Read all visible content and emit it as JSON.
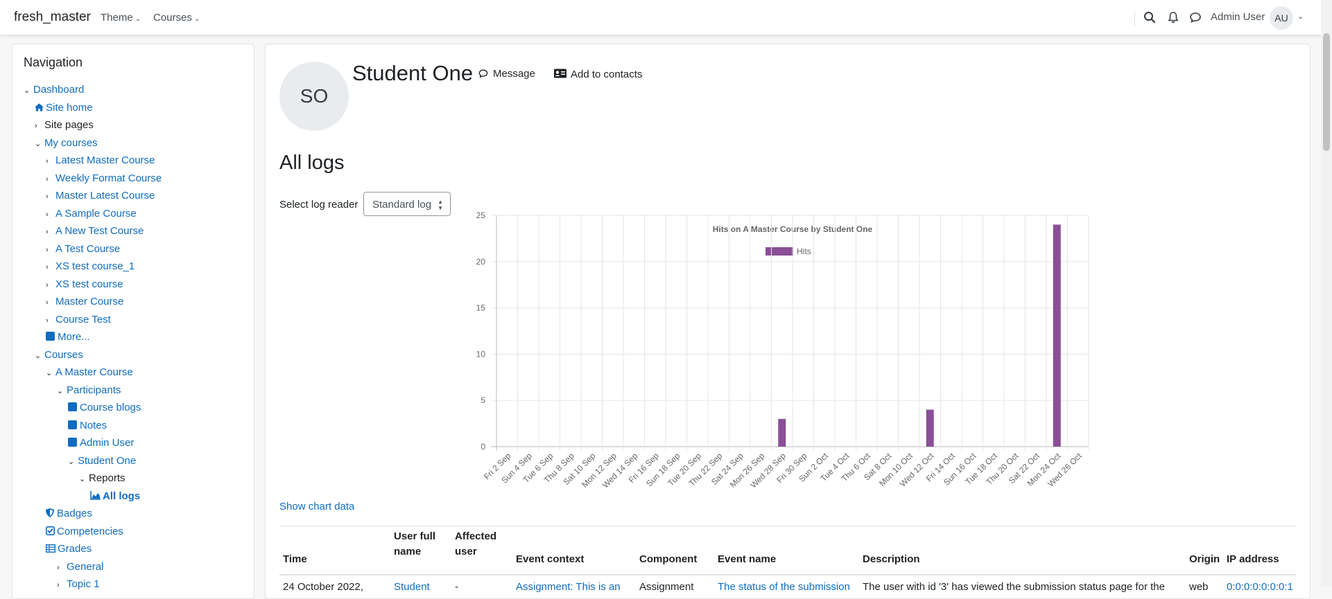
{
  "navbar": {
    "brand": "fresh_master",
    "menu": [
      "Theme",
      "Courses"
    ],
    "user_name": "Admin User",
    "user_initials": "AU"
  },
  "navigation": {
    "title": "Navigation",
    "items": [
      {
        "label": "Dashboard",
        "icon": "chevron-down"
      },
      {
        "label": "Site home",
        "icon": "home-icon"
      },
      {
        "label": "Site pages",
        "icon": "chevron-right"
      },
      {
        "label": "My courses",
        "icon": "chevron-down"
      },
      {
        "label": "Latest Master Course",
        "icon": "chevron-right"
      },
      {
        "label": "Weekly Format Course",
        "icon": "chevron-right"
      },
      {
        "label": "Master Latest Course",
        "icon": "chevron-right"
      },
      {
        "label": "A Sample Course",
        "icon": "chevron-right"
      },
      {
        "label": "A New Test Course",
        "icon": "chevron-right"
      },
      {
        "label": "A Test Course",
        "icon": "chevron-right"
      },
      {
        "label": "XS test course_1",
        "icon": "chevron-right"
      },
      {
        "label": "XS test course",
        "icon": "chevron-right"
      },
      {
        "label": "Master Course",
        "icon": "chevron-right"
      },
      {
        "label": "Course Test",
        "icon": "chevron-right"
      },
      {
        "label": "More...",
        "icon": "square-icon"
      },
      {
        "label": "Courses",
        "icon": "chevron-down"
      },
      {
        "label": "A Master Course",
        "icon": "chevron-down"
      },
      {
        "label": "Participants",
        "icon": "chevron-down"
      },
      {
        "label": "Course blogs",
        "icon": "square-icon"
      },
      {
        "label": "Notes",
        "icon": "square-icon"
      },
      {
        "label": "Admin User",
        "icon": "square-icon"
      },
      {
        "label": "Student One",
        "icon": "chevron-down"
      },
      {
        "label": "Reports",
        "icon": "chevron-down"
      },
      {
        "label": "All logs",
        "icon": "area-chart-icon"
      },
      {
        "label": "Badges",
        "icon": "shield-icon"
      },
      {
        "label": "Competencies",
        "icon": "checkbox-icon"
      },
      {
        "label": "Grades",
        "icon": "table-icon"
      },
      {
        "label": "General",
        "icon": "chevron-right"
      },
      {
        "label": "Topic 1",
        "icon": "chevron-right"
      }
    ]
  },
  "profile": {
    "initials": "SO",
    "name": "Student One",
    "message_label": "Message",
    "contacts_label": "Add to contacts"
  },
  "page": {
    "title": "All logs",
    "select_label": "Select log reader",
    "select_value": "Standard log",
    "show_chart_data": "Show chart data"
  },
  "chart_data": {
    "type": "bar",
    "title": "Hits on A Master Course by Student One",
    "legend": "top",
    "series": [
      {
        "name": "Hits",
        "color": "#8a4f96"
      }
    ],
    "categories": [
      "Fri 2 Sep",
      "Sun 4 Sep",
      "Tue 6 Sep",
      "Thu 8 Sep",
      "Sat 10 Sep",
      "Mon 12 Sep",
      "Wed 14 Sep",
      "Fri 16 Sep",
      "Sun 18 Sep",
      "Tue 20 Sep",
      "Thu 22 Sep",
      "Sat 24 Sep",
      "Mon 26 Sep",
      "Wed 28 Sep",
      "Fri 30 Sep",
      "Sun 2 Oct",
      "Tue 4 Oct",
      "Thu 6 Oct",
      "Sat 8 Oct",
      "Mon 10 Oct",
      "Wed 12 Oct",
      "Fri 14 Oct",
      "Sun 16 Oct",
      "Tue 18 Oct",
      "Thu 20 Oct",
      "Sat 22 Oct",
      "Mon 24 Oct",
      "Wed 26 Oct"
    ],
    "values": [
      0,
      0,
      0,
      0,
      0,
      0,
      0,
      0,
      0,
      0,
      0,
      0,
      0,
      3,
      0,
      0,
      0,
      0,
      0,
      0,
      4,
      0,
      0,
      0,
      0,
      0,
      24,
      0
    ],
    "ylim": [
      0,
      25
    ],
    "yticks": [
      0,
      5,
      10,
      15,
      20,
      25
    ],
    "grid": true
  },
  "table": {
    "headers": [
      "Time",
      "User full name",
      "Affected user",
      "Event context",
      "Component",
      "Event name",
      "Description",
      "Origin",
      "IP address"
    ],
    "row": [
      "24 October 2022,",
      "Student",
      "-",
      "Assignment: This is an",
      "Assignment",
      "The status of the submission",
      "The user with id '3' has viewed the submission status page for the",
      "web",
      "0:0:0:0:0:0:0:1"
    ]
  }
}
